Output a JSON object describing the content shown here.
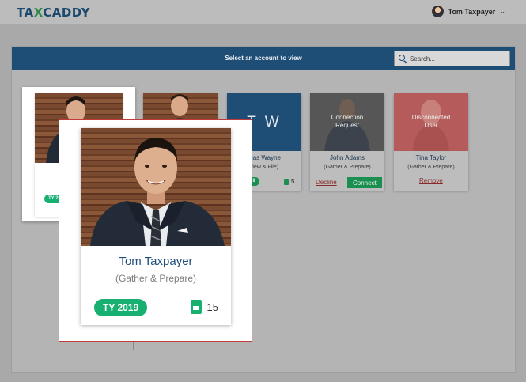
{
  "header": {
    "logo_left": "TA",
    "logo_x": "X",
    "logo_right": "CADDY",
    "user_name": "Tom Taxpayer",
    "menu_chevron": "⌄"
  },
  "panel": {
    "title": "Select an account to view",
    "search_placeholder": "Search..."
  },
  "cards": [
    {
      "name": "Thomas Wayne",
      "name_visible": "mas Wayne",
      "role_visible": "view & File)",
      "initials": "T W",
      "tag_visible": "19",
      "file_count": "5"
    },
    {
      "overlay_line1": "Connection",
      "overlay_line2": "Request",
      "name": "John Adams",
      "role": "(Gather & Prepare)",
      "decline_label": "Decline",
      "connect_label": "Connect"
    },
    {
      "overlay_line1": "Disconnected",
      "overlay_line2": "User",
      "name": "Tina Taylor",
      "role": "(Gather & Prepare)",
      "remove_label": "Remove"
    }
  ],
  "back_card": {
    "role_visible": "(G",
    "tag_visible": "TY 20"
  },
  "zoom_card": {
    "name": "Tom Taxpayer",
    "role": "(Gather & Prepare)",
    "tag": "TY 2019",
    "file_count": "15"
  },
  "colors": {
    "navy": "#1e4d76",
    "green": "#18b070",
    "red_link": "#8a2a2a",
    "zoom_border": "#c23b3b"
  }
}
